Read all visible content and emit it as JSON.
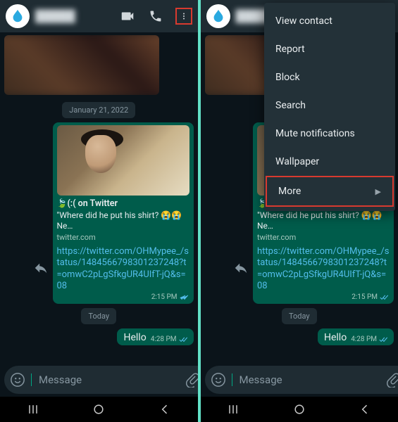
{
  "contact_name": "█████",
  "dates": {
    "jan21": "January 21, 2022",
    "today": "Today"
  },
  "preview": {
    "title_prefix": "🍃(:( on Twitter",
    "desc": "\"Where did he put his shirt? 😭😭Ne…",
    "site": "twitter.com"
  },
  "link_text": "https://twitter.com/OHMypee_/status/1484566798301237248?t=omwC2pLgSfkgUR4UIfT-jQ&s=08",
  "times": {
    "link": "2:15 PM",
    "hello": "4:28 PM"
  },
  "hello_text": "Hello",
  "input_placeholder": "Message",
  "menu": {
    "view_contact": "View contact",
    "report": "Report",
    "block": "Block",
    "search": "Search",
    "mute": "Mute notifications",
    "wallpaper": "Wallpaper",
    "more": "More"
  }
}
